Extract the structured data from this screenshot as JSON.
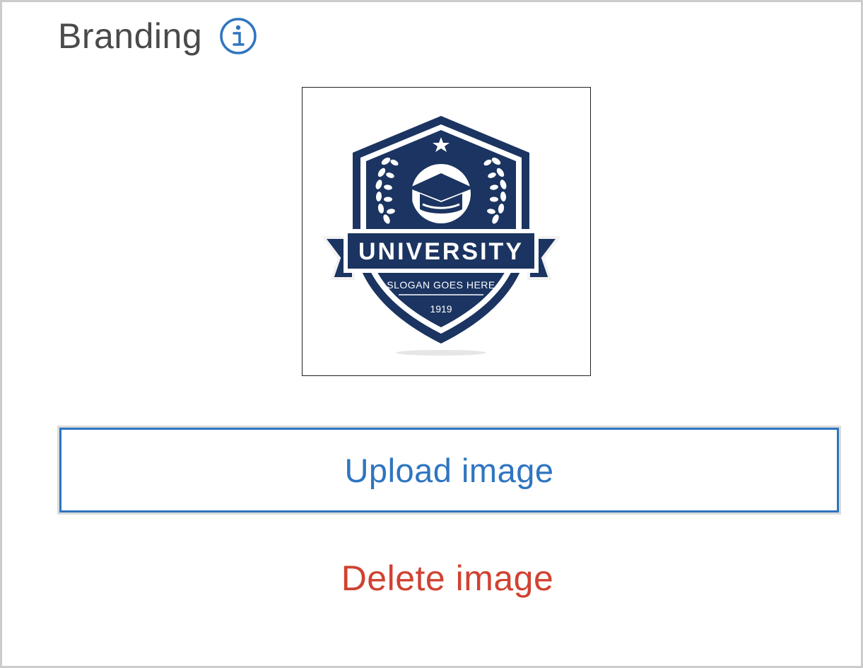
{
  "section": {
    "title": "Branding",
    "info_icon": "info-circle-icon"
  },
  "logo": {
    "main_text": "UNIVERSITY",
    "slogan": "SLOGAN GOES HERE",
    "year": "1919",
    "primary_color": "#1b3461"
  },
  "actions": {
    "upload_label": "Upload image",
    "delete_label": "Delete image"
  },
  "colors": {
    "accent": "#2e75c0",
    "danger": "#d04232",
    "title": "#4a4a4a",
    "border": "#cccccc"
  }
}
